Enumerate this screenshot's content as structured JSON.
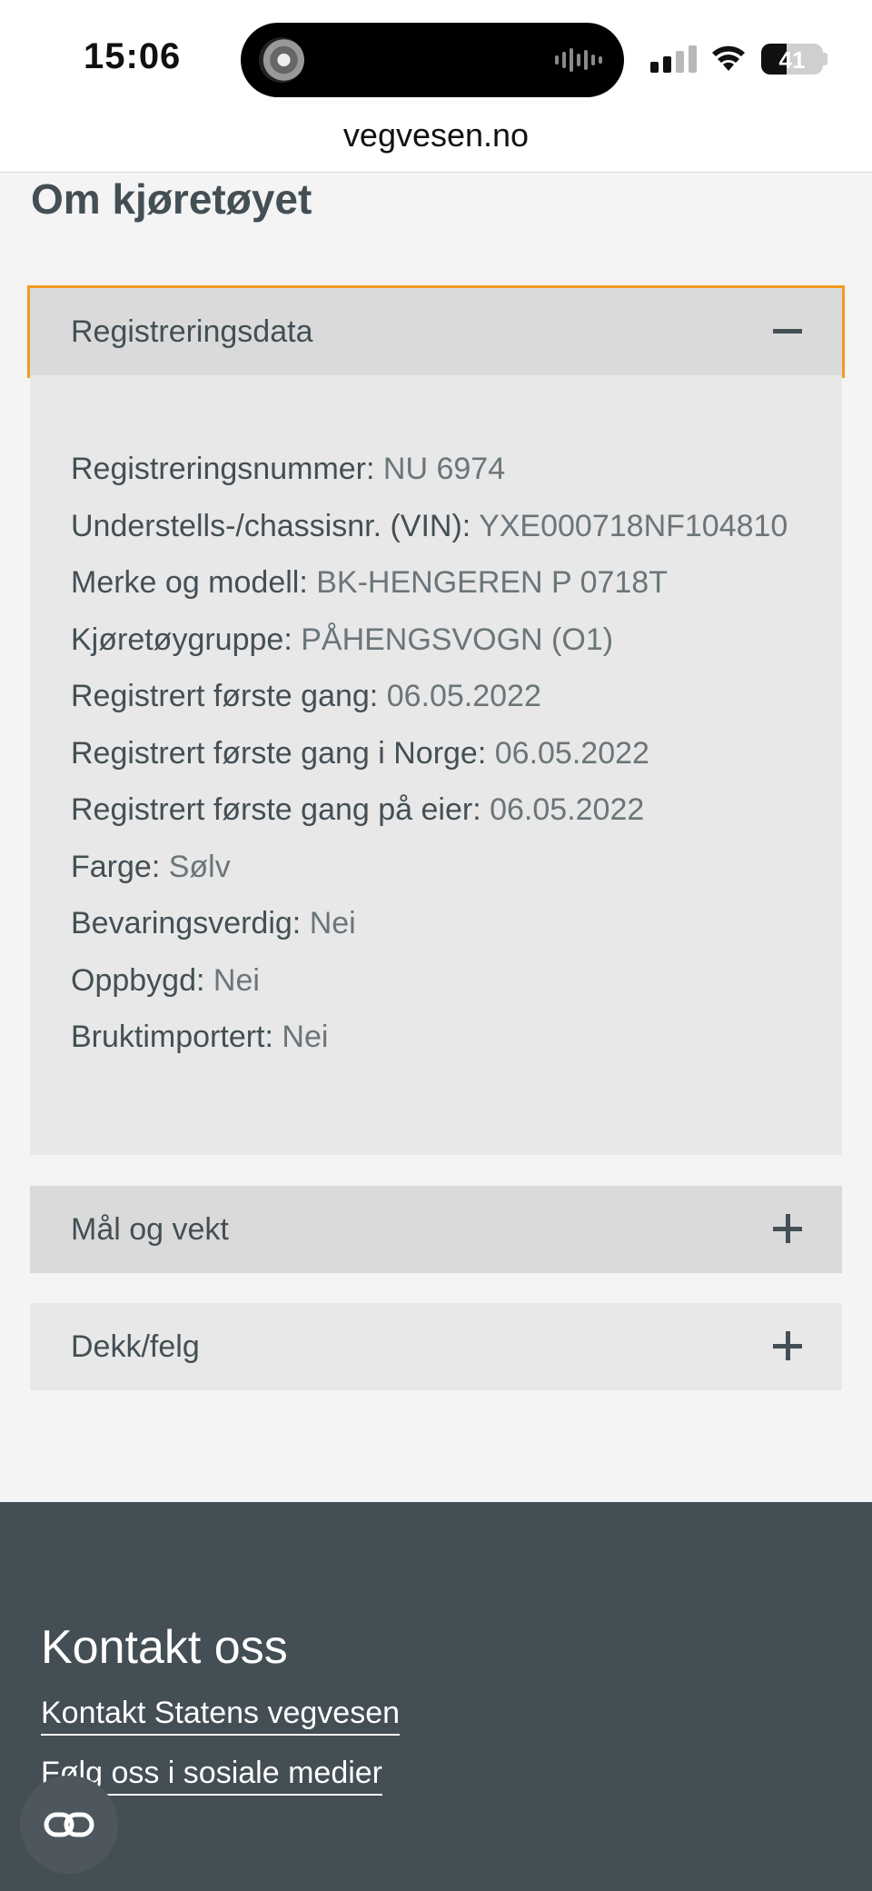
{
  "status_bar": {
    "time": "15:06",
    "battery_percent": "41",
    "battery_level": 0.41,
    "signal_bars_active": 2,
    "signal_bars_total": 4
  },
  "browser": {
    "url": "vegvesen.no"
  },
  "section": {
    "title": "Om kjøretøyet"
  },
  "accordions": [
    {
      "label": "Registreringsdata",
      "expanded": true,
      "icon": "minus-icon",
      "rows": [
        {
          "key": "Registreringsnummer:",
          "value": "NU 6974"
        },
        {
          "key": "Understells-/chassisnr. (VIN):",
          "value": "YXE000718NF104810"
        },
        {
          "key": "Merke og modell:",
          "value": "BK-HENGEREN P 0718T"
        },
        {
          "key": "Kjøretøygruppe:",
          "value": "PÅHENGSVOGN (O1)"
        },
        {
          "key": "Registrert første gang:",
          "value": "06.05.2022"
        },
        {
          "key": "Registrert første gang i Norge:",
          "value": "06.05.2022"
        },
        {
          "key": "Registrert første gang på eier:",
          "value": "06.05.2022"
        },
        {
          "key": "Farge:",
          "value": "Sølv"
        },
        {
          "key": "Bevaringsverdig:",
          "value": "Nei"
        },
        {
          "key": "Oppbygd:",
          "value": "Nei"
        },
        {
          "key": "Bruktimportert:",
          "value": "Nei"
        }
      ]
    },
    {
      "label": "Mål og vekt",
      "expanded": false,
      "icon": "plus-icon"
    },
    {
      "label": "Dekk/felg",
      "expanded": false,
      "icon": "plus-icon"
    }
  ],
  "footer": {
    "title": "Kontakt oss",
    "links": [
      "Kontakt Statens vegvesen",
      "Følg oss i sosiale medier"
    ]
  },
  "colors": {
    "accent_focus": "#f29a1e",
    "text": "#444f55",
    "footer_bg": "#444e55"
  }
}
